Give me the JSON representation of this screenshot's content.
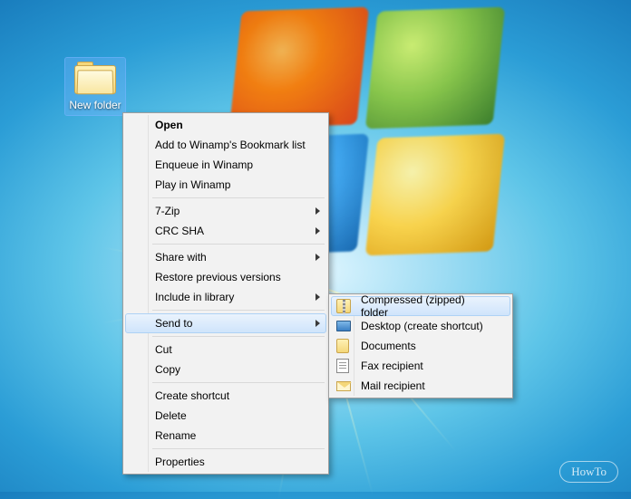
{
  "desktop_icon": {
    "label": "New folder"
  },
  "context_menu": {
    "groups": [
      [
        {
          "label": "Open",
          "bold": true,
          "submenu": false
        },
        {
          "label": "Add to Winamp's Bookmark list",
          "submenu": false
        },
        {
          "label": "Enqueue in Winamp",
          "submenu": false
        },
        {
          "label": "Play in Winamp",
          "submenu": false
        }
      ],
      [
        {
          "label": "7-Zip",
          "submenu": true
        },
        {
          "label": "CRC SHA",
          "submenu": true
        }
      ],
      [
        {
          "label": "Share with",
          "submenu": true
        },
        {
          "label": "Restore previous versions",
          "submenu": false
        },
        {
          "label": "Include in library",
          "submenu": true
        }
      ],
      [
        {
          "label": "Send to",
          "submenu": true,
          "highlight": true
        }
      ],
      [
        {
          "label": "Cut",
          "submenu": false
        },
        {
          "label": "Copy",
          "submenu": false
        }
      ],
      [
        {
          "label": "Create shortcut",
          "submenu": false
        },
        {
          "label": "Delete",
          "submenu": false
        },
        {
          "label": "Rename",
          "submenu": false
        }
      ],
      [
        {
          "label": "Properties",
          "submenu": false
        }
      ]
    ]
  },
  "submenu": {
    "items": [
      {
        "label": "Compressed (zipped) folder",
        "icon": "zip",
        "highlight": true
      },
      {
        "label": "Desktop (create shortcut)",
        "icon": "desk"
      },
      {
        "label": "Documents",
        "icon": "docs"
      },
      {
        "label": "Fax recipient",
        "icon": "fax"
      },
      {
        "label": "Mail recipient",
        "icon": "mail"
      }
    ]
  },
  "watermark": {
    "text": "HowTo"
  }
}
